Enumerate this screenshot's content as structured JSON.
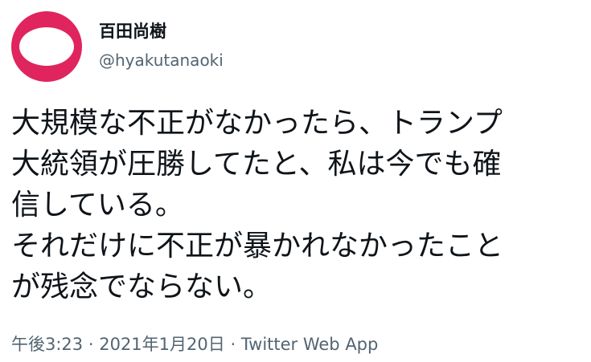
{
  "author": {
    "display_name": "百田尚樹",
    "handle": "@hyakutanaoki",
    "avatar_color": "#e0245e"
  },
  "tweet": {
    "lines": [
      "大規模な不正がなかったら、トランプ",
      "大統領が圧勝してたと、私は今でも確",
      "信している。",
      "それだけに不正が暴かれなかったこと",
      "が残念でならない。"
    ]
  },
  "meta": {
    "time": "午後3:23",
    "separator": "·",
    "date": "2021年1月20日",
    "source": "Twitter Web App"
  }
}
